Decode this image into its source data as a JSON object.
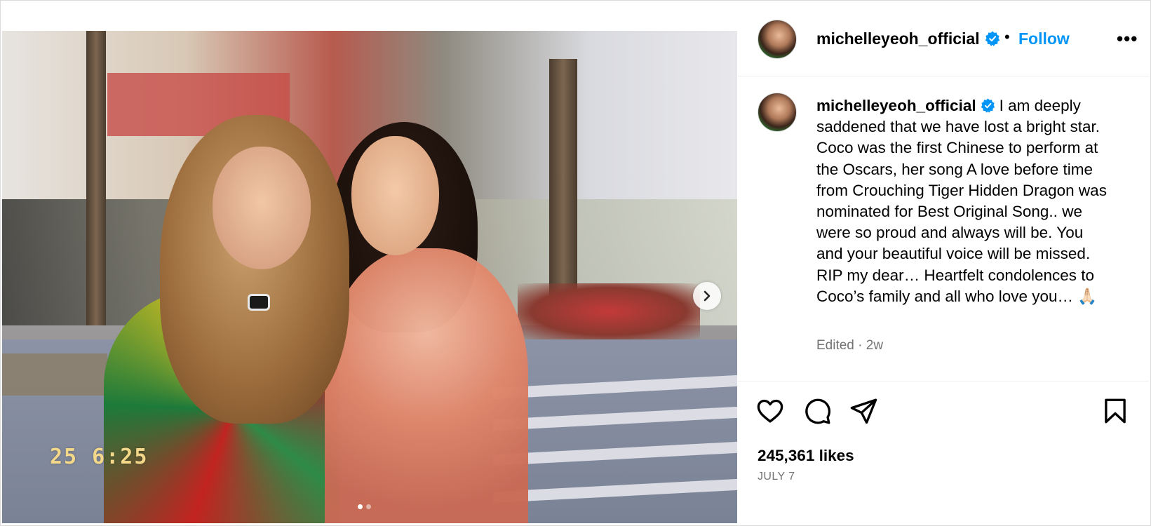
{
  "post": {
    "username": "michelleyeoh_official",
    "follow_label": "Follow",
    "separator": "•",
    "more_label": "•••",
    "caption_text": "I am deeply saddened that we have lost a bright star. Coco was the first Chinese to perform at the Oscars, her song A love before time from Crouching Tiger Hidden Dragon was nominated for Best Original Song.. we were so proud and always will be. You and your beautiful voice will be missed. RIP my dear… Heartfelt condolences to Coco’s family and all who love you… ",
    "caption_emoji": "🙏🏻",
    "edited_label": "Edited · 2w",
    "likes": "245,361 likes",
    "date": "JULY 7"
  },
  "media": {
    "overlay_timestamp": "25  6:25",
    "carousel_count": 2,
    "carousel_active": 1
  },
  "icons": {
    "verified": "verified-badge-icon",
    "like": "heart-icon",
    "comment": "comment-icon",
    "share": "share-icon",
    "save": "bookmark-icon",
    "next": "chevron-right-icon"
  },
  "colors": {
    "accent": "#0095f6",
    "secondary_text": "#737373",
    "border": "#efefef"
  }
}
